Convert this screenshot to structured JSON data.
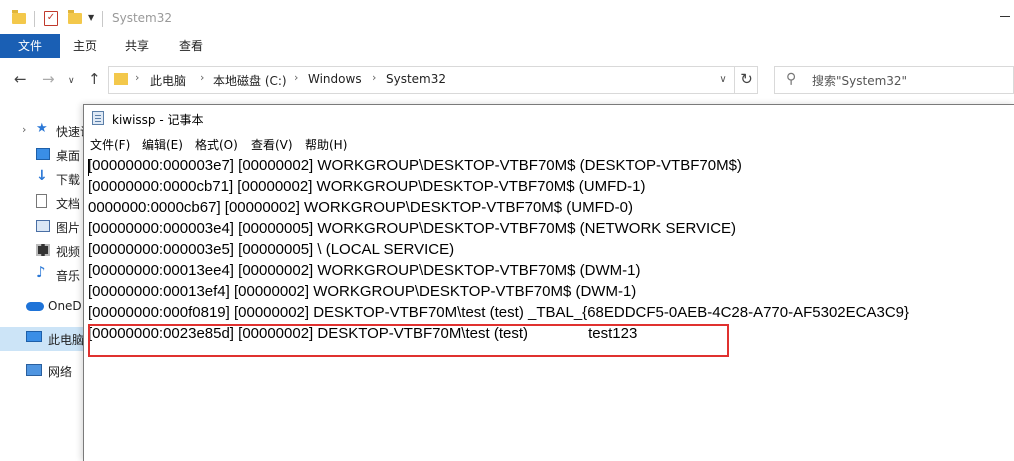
{
  "explorer": {
    "title": "System32",
    "ribbon_tabs": [
      "文件",
      "主页",
      "共享",
      "查看"
    ],
    "breadcrumb": [
      "此电脑",
      "本地磁盘 (C:)",
      "Windows",
      "System32"
    ],
    "search_placeholder": "搜索\"System32\"",
    "sidebar": [
      {
        "label": "快速访",
        "icon": "star-icon"
      },
      {
        "label": "桌面",
        "icon": "desktop-icon"
      },
      {
        "label": "下载",
        "icon": "download-icon"
      },
      {
        "label": "文档",
        "icon": "document-icon"
      },
      {
        "label": "图片",
        "icon": "picture-icon"
      },
      {
        "label": "视频",
        "icon": "video-icon"
      },
      {
        "label": "音乐",
        "icon": "music-icon"
      },
      {
        "label": "OneD",
        "icon": "cloud-icon"
      },
      {
        "label": "此电脑",
        "icon": "computer-icon"
      },
      {
        "label": "网络",
        "icon": "network-icon"
      }
    ]
  },
  "notepad": {
    "title": "kiwissp - 记事本",
    "menu": [
      "文件(F)",
      "编辑(E)",
      "格式(O)",
      "查看(V)",
      "帮助(H)"
    ],
    "lines": [
      "[00000000:000003e7] [00000002] WORKGROUP\\DESKTOP-VTBF70M$ (DESKTOP-VTBF70M$)",
      "[00000000:0000cb71] [00000002] WORKGROUP\\DESKTOP-VTBF70M$ (UMFD-1)",
      "0000000:0000cb67] [00000002] WORKGROUP\\DESKTOP-VTBF70M$ (UMFD-0)",
      "[00000000:000003e4] [00000005] WORKGROUP\\DESKTOP-VTBF70M$ (NETWORK SERVICE)",
      "[00000000:000003e5] [00000005] \\ (LOCAL SERVICE)",
      "[00000000:00013ee4] [00000002] WORKGROUP\\DESKTOP-VTBF70M$ (DWM-1)",
      "[00000000:00013ef4] [00000002] WORKGROUP\\DESKTOP-VTBF70M$ (DWM-1)",
      "[00000000:000f0819] [00000002] DESKTOP-VTBF70M\\test (test) _TBAL_{68EDDCF5-0AEB-4C28-A770-AF5302ECA3C9}",
      "[00000000:0023e85d] [00000002] DESKTOP-VTBF70M\\test (test)\t\ttest123"
    ]
  },
  "colors": {
    "ribbon_active": "#1a5fb4",
    "highlight_border": "#e0312f",
    "selected_sidebar": "#cce4f7"
  }
}
